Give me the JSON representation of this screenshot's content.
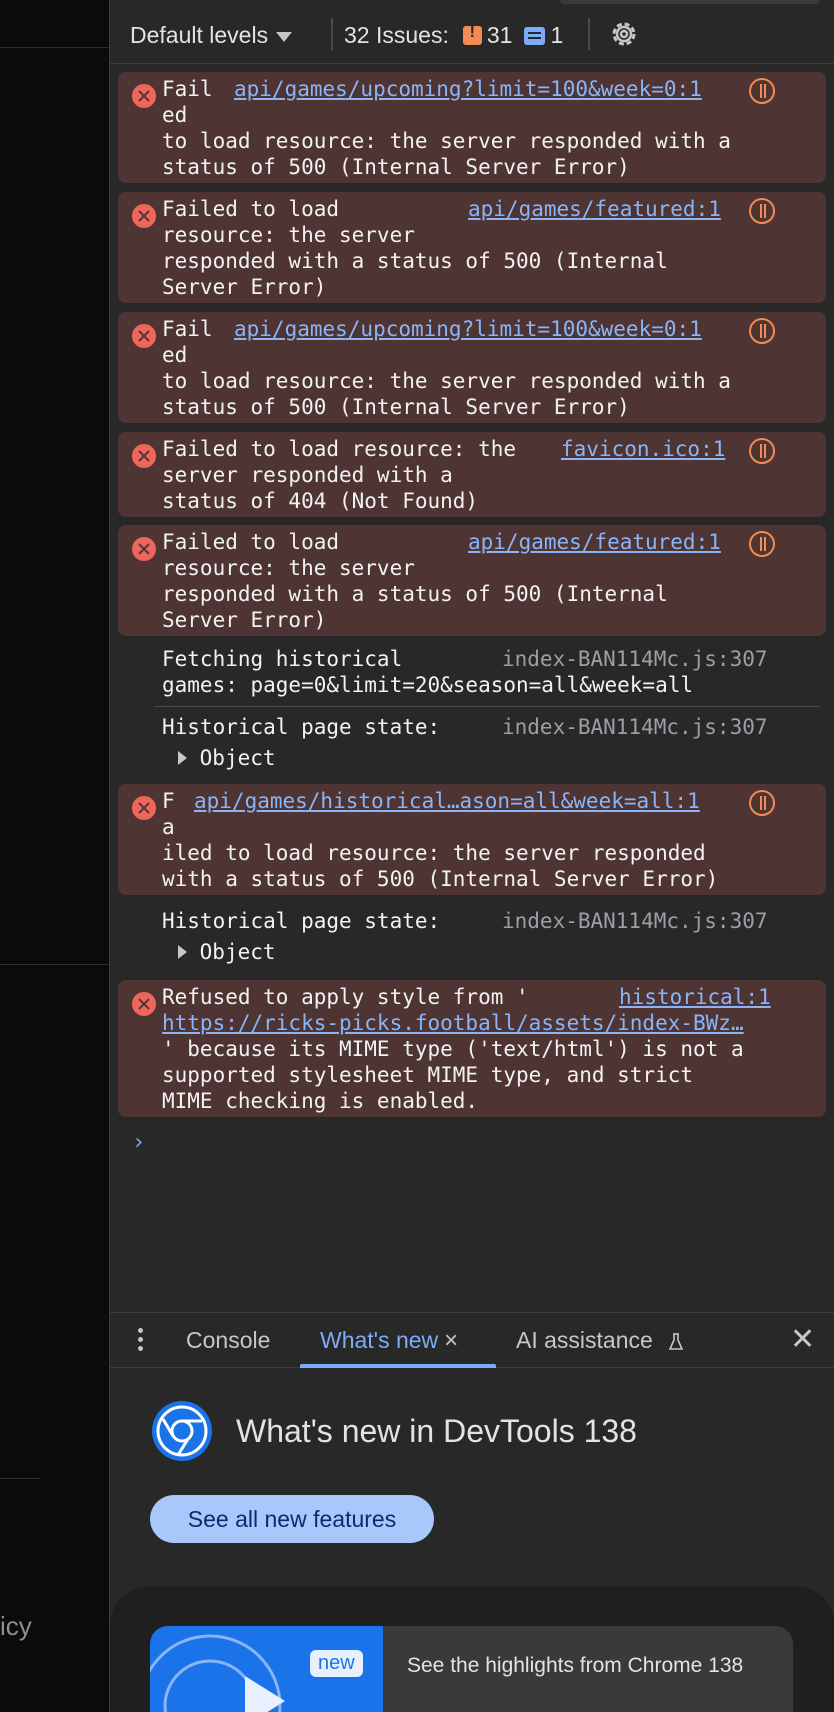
{
  "page_left": {
    "policy_text": "icy"
  },
  "toolbar": {
    "levels_label": "Default levels",
    "issues_label": "32 Issues:",
    "warning_count": "31",
    "info_count": "1"
  },
  "console": {
    "messages": [
      {
        "kind": "error",
        "lines": [
          "Fail",
          "ed",
          "to load resource: the server responded with a",
          "status of 500 (Internal Server Error)"
        ],
        "source": "api/games/upcoming?limit=100&week=0:1"
      },
      {
        "kind": "error",
        "lines": [
          "Failed to load",
          "resource: the server",
          "responded with a status of 500 (Internal",
          "Server Error)"
        ],
        "source": "api/games/featured:1"
      },
      {
        "kind": "error",
        "lines": [
          "Fail",
          "ed",
          "to load resource: the server responded with a",
          "status of 500 (Internal Server Error)"
        ],
        "source": "api/games/upcoming?limit=100&week=0:1"
      },
      {
        "kind": "error",
        "lines": [
          "Failed to load resource: the",
          "server responded with a",
          "status of 404 (Not Found)"
        ],
        "source": "favicon.ico:1"
      },
      {
        "kind": "error",
        "lines": [
          "Failed to load",
          "resource: the server",
          "responded with a status of 500 (Internal",
          "Server Error)"
        ],
        "source": "api/games/featured:1"
      },
      {
        "kind": "log",
        "lines": [
          "Fetching historical",
          "games: page=0&limit=20&season=all&week=all"
        ],
        "source": "index-BAN114Mc.js:307"
      },
      {
        "kind": "log",
        "lines": [
          "Historical page state:"
        ],
        "source": "index-BAN114Mc.js:307",
        "object_label": "Object"
      },
      {
        "kind": "error",
        "lines": [
          "F",
          "a",
          "iled to load resource: the server responded",
          "with a status of 500 (Internal Server Error)"
        ],
        "source": "api/games/historical…ason=all&week=all:1"
      },
      {
        "kind": "log",
        "lines": [
          "Historical page state:"
        ],
        "source": "index-BAN114Mc.js:307",
        "object_label": "Object"
      },
      {
        "kind": "error",
        "lines": [
          "Refused to apply style from '",
          "https://ricks-picks.football/assets/index-BWz…",
          "' because its MIME type ('text/html') is not a",
          "supported stylesheet MIME type, and strict",
          "MIME checking is enabled."
        ],
        "source": "historical:1"
      }
    ],
    "prompt": "›"
  },
  "drawer": {
    "tabs": [
      {
        "label": "Console"
      },
      {
        "label": "What's new"
      },
      {
        "label": "AI assistance"
      }
    ],
    "tab_close_glyph": "×",
    "drawer_close_glyph": "✕",
    "whats_new": {
      "title": "What's new in DevTools 138",
      "button_label": "See all new features",
      "card_badge": "new",
      "card_text": "See the highlights from Chrome 138"
    }
  },
  "colors": {
    "panel_bg": "#282828",
    "error_bg": "#4e3534",
    "error_icon": "#ee675c",
    "link": "#8ab4f8",
    "accent": "#7cacf8",
    "warning": "#f28b54",
    "button_bg": "#a8c7fa"
  }
}
